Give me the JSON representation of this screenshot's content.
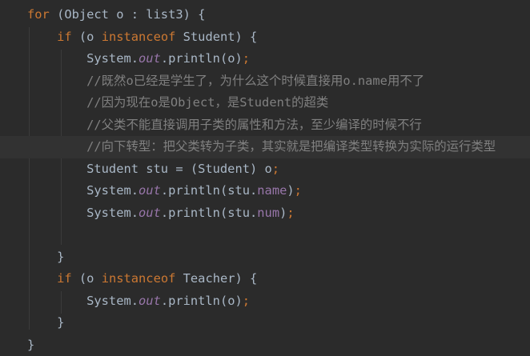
{
  "editor": {
    "language": "java",
    "colors": {
      "background": "#2b2b2b",
      "current_line": "#323232",
      "default_text": "#a9b7c6",
      "keyword": "#cc7832",
      "static_field": "#9876aa",
      "comment": "#808080"
    },
    "lines": [
      {
        "tokens": [
          {
            "t": "for",
            "c": "kw"
          },
          {
            "t": " (Object o : list3) {",
            "c": "p"
          }
        ]
      },
      {
        "tokens": [
          {
            "t": "    ",
            "c": "p"
          },
          {
            "t": "if",
            "c": "kw"
          },
          {
            "t": " (o ",
            "c": "p"
          },
          {
            "t": "instanceof",
            "c": "kw"
          },
          {
            "t": " Student) {",
            "c": "p"
          }
        ]
      },
      {
        "tokens": [
          {
            "t": "        System.",
            "c": "p"
          },
          {
            "t": "out",
            "c": "fld"
          },
          {
            "t": ".println(o)",
            "c": "p"
          },
          {
            "t": ";",
            "c": "kw"
          }
        ]
      },
      {
        "tokens": [
          {
            "t": "        //既然o已经是学生了，为什么这个时候直接用o.name用不了",
            "c": "cmt"
          }
        ]
      },
      {
        "tokens": [
          {
            "t": "        //因为现在o是Object，是Student的超类",
            "c": "cmt"
          }
        ]
      },
      {
        "tokens": [
          {
            "t": "        //父类不能直接调用子类的属性和方法，至少编译的时候不行",
            "c": "cmt"
          }
        ]
      },
      {
        "tokens": [
          {
            "t": "        //向下转型：把父类转为子类，其实就是把编译类型转换为实际的运行类型",
            "c": "cmt"
          }
        ],
        "highlight": true
      },
      {
        "tokens": [
          {
            "t": "        Student stu = (Student) o",
            "c": "p"
          },
          {
            "t": ";",
            "c": "kw"
          }
        ]
      },
      {
        "tokens": [
          {
            "t": "        System.",
            "c": "p"
          },
          {
            "t": "out",
            "c": "fld"
          },
          {
            "t": ".println(stu.",
            "c": "p"
          },
          {
            "t": "name",
            "c": "prop"
          },
          {
            "t": ")",
            "c": "p"
          },
          {
            "t": ";",
            "c": "kw"
          }
        ]
      },
      {
        "tokens": [
          {
            "t": "        System.",
            "c": "p"
          },
          {
            "t": "out",
            "c": "fld"
          },
          {
            "t": ".println(stu.",
            "c": "p"
          },
          {
            "t": "num",
            "c": "prop"
          },
          {
            "t": ")",
            "c": "p"
          },
          {
            "t": ";",
            "c": "kw"
          }
        ]
      },
      {
        "tokens": []
      },
      {
        "tokens": [
          {
            "t": "    }",
            "c": "p"
          }
        ]
      },
      {
        "tokens": [
          {
            "t": "    ",
            "c": "p"
          },
          {
            "t": "if",
            "c": "kw"
          },
          {
            "t": " (o ",
            "c": "p"
          },
          {
            "t": "instanceof",
            "c": "kw"
          },
          {
            "t": " Teacher) {",
            "c": "p"
          }
        ]
      },
      {
        "tokens": [
          {
            "t": "        System.",
            "c": "p"
          },
          {
            "t": "out",
            "c": "fld"
          },
          {
            "t": ".println(o)",
            "c": "p"
          },
          {
            "t": ";",
            "c": "kw"
          }
        ]
      },
      {
        "tokens": [
          {
            "t": "    }",
            "c": "p"
          }
        ]
      },
      {
        "tokens": [
          {
            "t": "}",
            "c": "p"
          }
        ]
      }
    ]
  }
}
